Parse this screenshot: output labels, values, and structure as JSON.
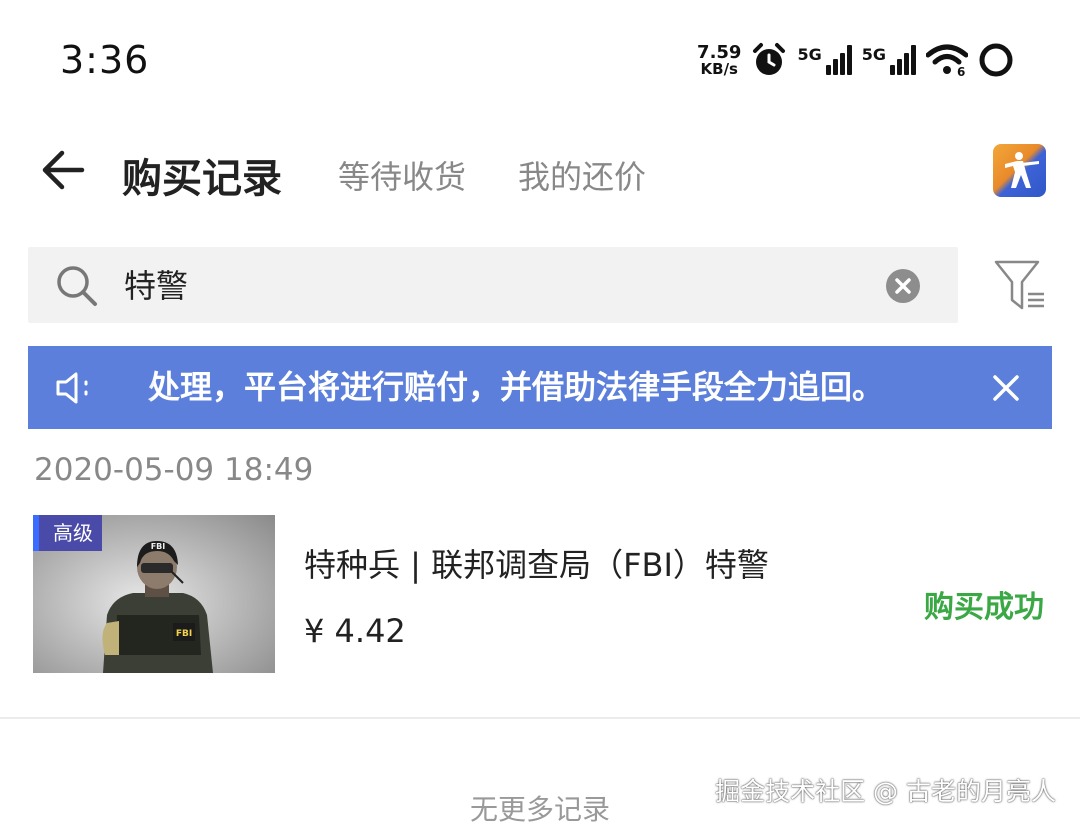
{
  "status_bar": {
    "time": "3:36",
    "net_speed_value": "7.59",
    "net_speed_unit": "KB/s",
    "sim1_label": "5G",
    "sim2_label": "5G",
    "wifi_badge": "6",
    "icons": [
      "alarm-icon",
      "signal-icon",
      "wifi-icon",
      "battery-ring-icon"
    ]
  },
  "header": {
    "title": "购买记录",
    "tabs": [
      {
        "label": "等待收货"
      },
      {
        "label": "我的还价"
      }
    ],
    "back_icon": "arrow-left-icon",
    "game_icon": "csgo-game-icon"
  },
  "search": {
    "value": "特警",
    "icon": "search-icon",
    "clear_icon": "clear-icon",
    "filter_icon": "filter-icon"
  },
  "notice": {
    "text": "处理，平台将进行赔付，并借助法律手段全力追回。",
    "accent": "#5b7fdb"
  },
  "records": [
    {
      "date": "2020-05-09 18:49",
      "grade": "高级",
      "name": "特种兵 | 联邦调查局（FBI）特警",
      "price": "¥ 4.42",
      "status": "购买成功",
      "status_color": "#3aa844"
    }
  ],
  "footer": {
    "no_more": "无更多记录",
    "watermark": "掘金技术社区 @ 古老的月亮人"
  }
}
